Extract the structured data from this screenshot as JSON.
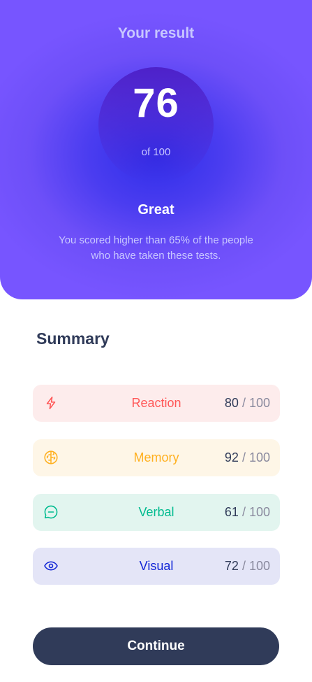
{
  "result": {
    "title": "Your result",
    "score": "76",
    "score_max_label": "of 100",
    "rating": "Great",
    "description": "You scored higher than 65% of the people who have taken these tests."
  },
  "summary": {
    "heading": "Summary",
    "items": [
      {
        "label": "Reaction",
        "score": "80",
        "max": " / 100",
        "icon": "lightning-icon",
        "color": "#ff5757"
      },
      {
        "label": "Memory",
        "score": "92",
        "max": " / 100",
        "icon": "brain-icon",
        "color": "#ffb01f"
      },
      {
        "label": "Verbal",
        "score": "61",
        "max": " / 100",
        "icon": "chat-bubble-icon",
        "color": "#00bb8f"
      },
      {
        "label": "Visual",
        "score": "72",
        "max": " / 100",
        "icon": "eye-icon",
        "color": "#1125d6"
      }
    ]
  },
  "actions": {
    "continue_label": "Continue"
  },
  "colors": {
    "accent_gradient_start": "#7755ff",
    "accent_gradient_end": "#2f2ee9",
    "dark_navy": "#303b59"
  }
}
